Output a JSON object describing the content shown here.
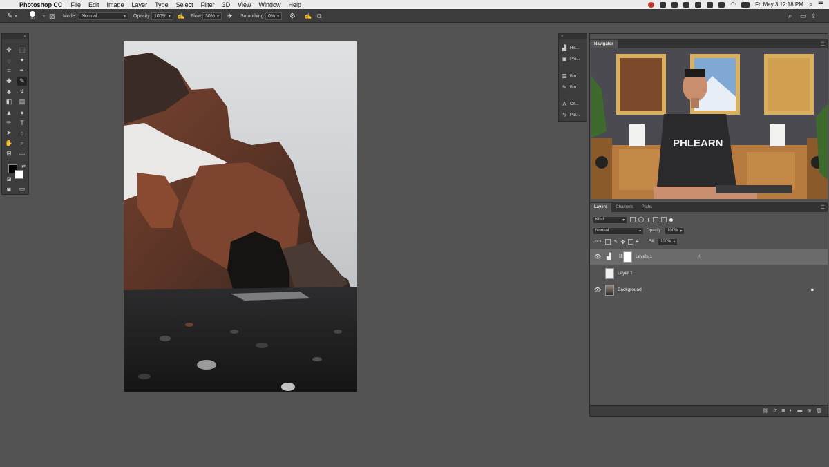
{
  "menubar": {
    "app_name": "Photoshop CC",
    "items": [
      "File",
      "Edit",
      "Image",
      "Layer",
      "Type",
      "Select",
      "Filter",
      "3D",
      "View",
      "Window",
      "Help"
    ],
    "clock": "Fri May 3  12:18 PM"
  },
  "options_bar": {
    "brush_size": "90",
    "mode_label": "Mode:",
    "mode_value": "Normal",
    "opacity_label": "Opacity:",
    "opacity_value": "100%",
    "flow_label": "Flow:",
    "flow_value": "30%",
    "smoothing_label": "Smoothing:",
    "smoothing_value": "0%"
  },
  "dock": {
    "items": [
      {
        "icon": "histogram-icon",
        "label": "His..."
      },
      {
        "icon": "properties-icon",
        "label": "Pro..."
      },
      {
        "icon": "brush-settings-icon",
        "label": "Bru..."
      },
      {
        "icon": "brushes-icon",
        "label": "Bru..."
      },
      {
        "icon": "character-icon",
        "label": "Ch..."
      },
      {
        "icon": "paragraph-icon",
        "label": "Par..."
      }
    ]
  },
  "navigator": {
    "tab": "Navigator",
    "shirt_text": "PHLEARN"
  },
  "layers_panel": {
    "tabs": [
      "Layers",
      "Channels",
      "Paths"
    ],
    "filter_label": "Kind",
    "blend_mode": "Normal",
    "opacity_label": "Opacity:",
    "opacity_value": "100%",
    "lock_label": "Lock:",
    "fill_label": "Fill:",
    "fill_value": "100%",
    "layers": [
      {
        "name": "Levels 1",
        "visible": true,
        "selected": true
      },
      {
        "name": "Layer 1",
        "visible": false,
        "selected": false
      },
      {
        "name": "Background",
        "visible": true,
        "selected": false,
        "locked": true
      }
    ]
  },
  "colors": {
    "workspace": "#535353",
    "panel": "#3c3c3c",
    "foreground_color": "#000000",
    "background_color": "#ffffff"
  }
}
